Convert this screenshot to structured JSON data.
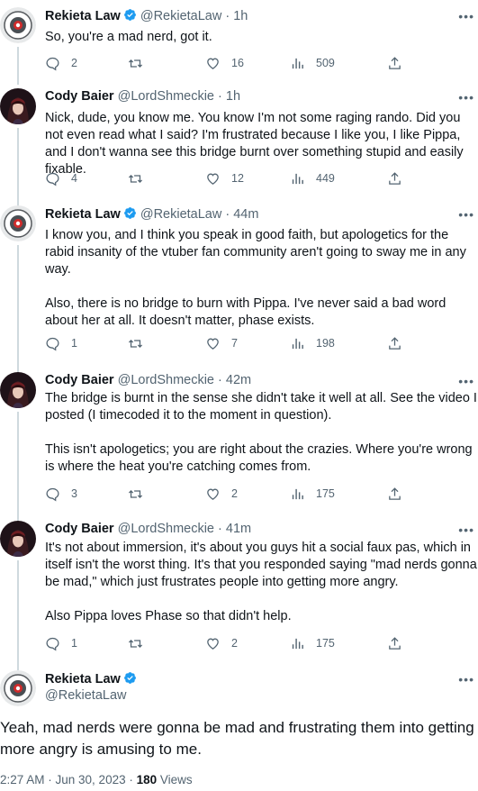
{
  "thread": [
    {
      "name": "Rekieta Law",
      "verified": true,
      "handle": "@RekietaLaw",
      "time": "· 1h",
      "avatar": "rekieta",
      "paragraphs": [
        "So, you're a mad nerd, got it."
      ],
      "replies": "2",
      "retweets": "",
      "likes": "16",
      "views": "509"
    },
    {
      "name": "Cody Baier",
      "verified": false,
      "handle": "@LordShmeckie",
      "time": "· 1h",
      "avatar": "cody",
      "paragraphs": [
        "Nick, dude, you know me. You know I'm not some raging rando. Did you not even read what I said? I'm frustrated because I like you, I like Pippa, and I don't wanna see this bridge burnt over something stupid and easily fixable."
      ],
      "replies": "4",
      "retweets": "",
      "likes": "12",
      "views": "449"
    },
    {
      "name": "Rekieta Law",
      "verified": true,
      "handle": "@RekietaLaw",
      "time": "· 44m",
      "avatar": "rekieta",
      "paragraphs": [
        "I know you, and I think you speak in good faith, but apologetics for the rabid insanity of the vtuber fan community aren't going to sway me in any way.",
        "Also, there is no bridge to burn with Pippa.  I've never said a bad word about her at all.  It doesn't matter, phase exists."
      ],
      "replies": "1",
      "retweets": "",
      "likes": "7",
      "views": "198"
    },
    {
      "name": "Cody Baier",
      "verified": false,
      "handle": "@LordShmeckie",
      "time": "· 42m",
      "avatar": "cody",
      "paragraphs": [
        "The bridge is burnt in the sense she didn't take it well at all. See the video I posted (I timecoded it to the moment in question).",
        "This isn't apologetics; you are right about the crazies. Where you're wrong is where the heat you're catching comes from."
      ],
      "replies": "3",
      "retweets": "",
      "likes": "2",
      "views": "175"
    },
    {
      "name": "Cody Baier",
      "verified": false,
      "handle": "@LordShmeckie",
      "time": "· 41m",
      "avatar": "cody",
      "paragraphs": [
        "It's not about immersion, it's about you guys hit a social faux pas, which in itself isn't the worst thing. It's that you responded saying \"mad nerds gonna be mad,\" which just frustrates people into getting more angry.",
        "Also Pippa loves Phase so that didn't help."
      ],
      "replies": "1",
      "retweets": "",
      "likes": "2",
      "views": "175"
    }
  ],
  "main_tweet": {
    "name": "Rekieta Law",
    "verified": true,
    "handle": "@RekietaLaw",
    "text": "Yeah, mad nerds were gonna be mad and frustrating them into getting more angry is amusing to me.",
    "time": "2:27 AM · Jun 30, 2023 · ",
    "views_count": "180",
    "views_label": " Views"
  },
  "colors": {
    "text": "#0f1419",
    "secondary": "#536471",
    "verified": "#1d9bf0",
    "thread_line": "#cfd9de"
  }
}
